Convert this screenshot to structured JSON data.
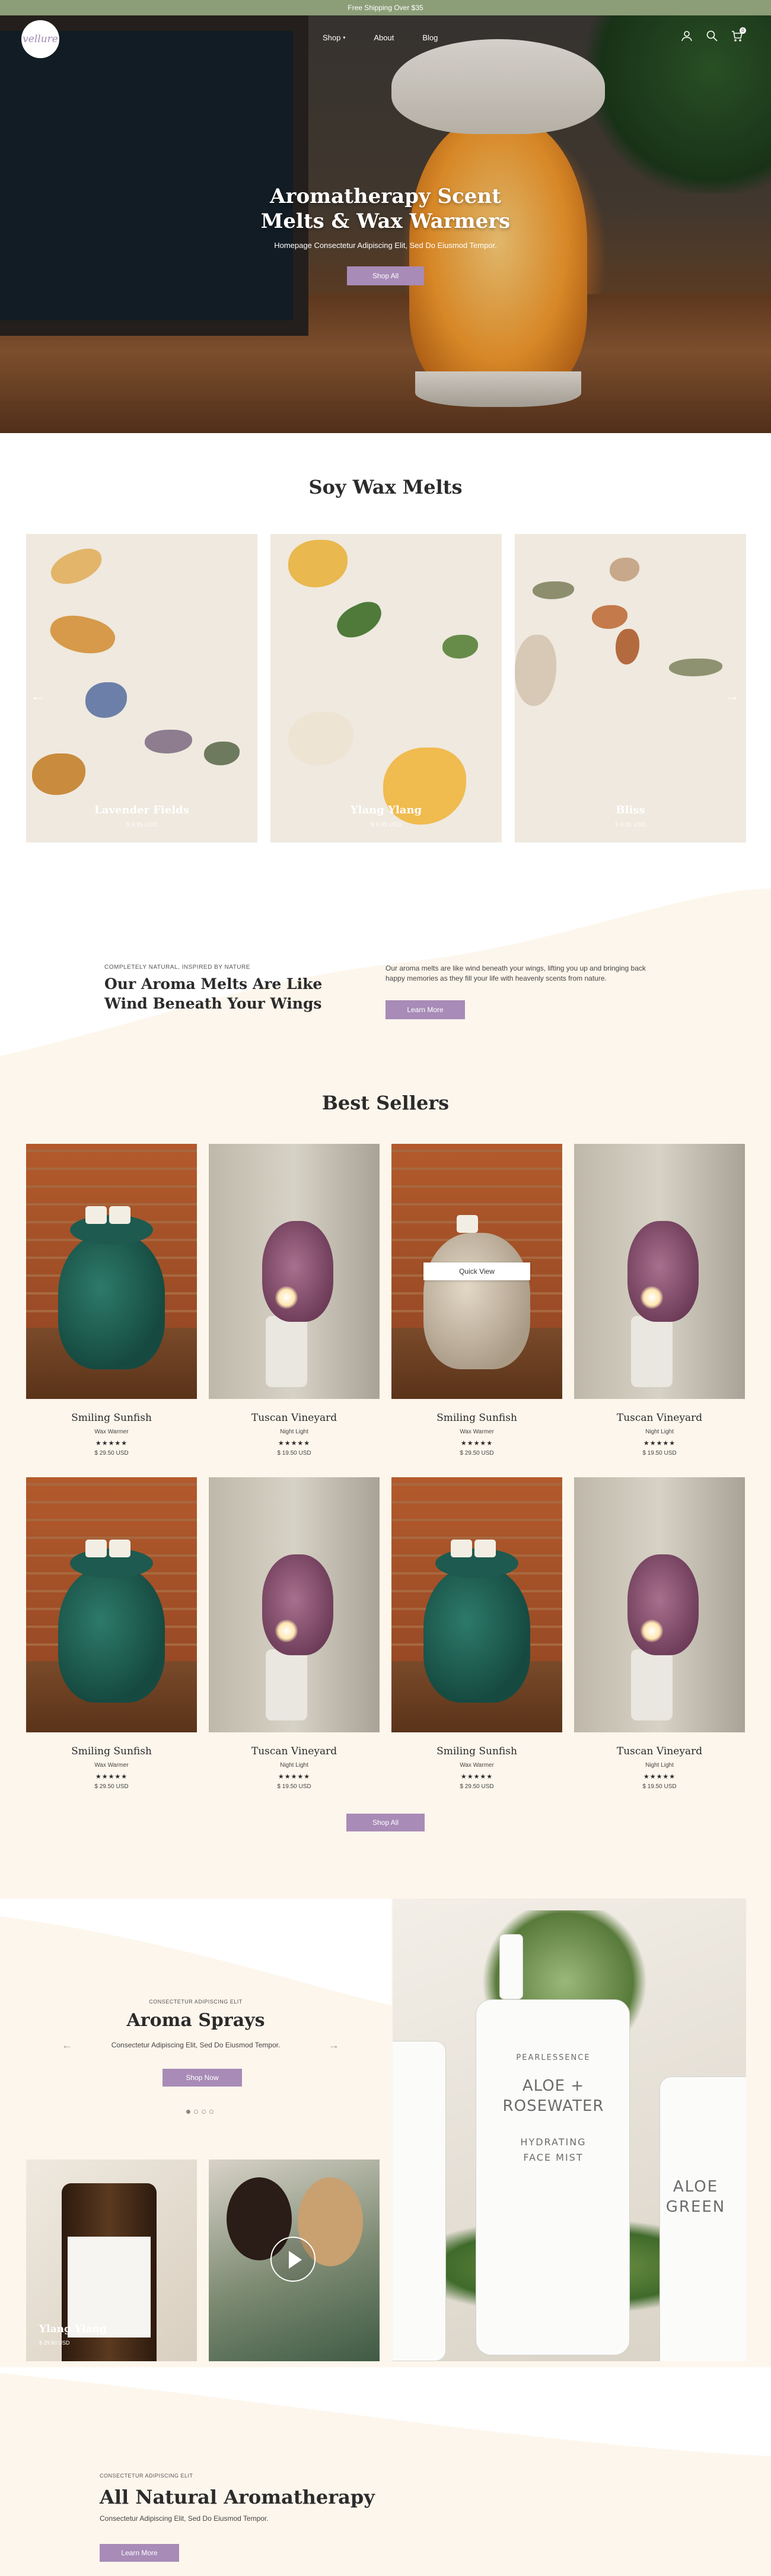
{
  "announcement": "Free Shipping Over $35",
  "nav": {
    "logo": "vellure",
    "links": [
      "Shop",
      "About",
      "Blog"
    ],
    "cart_count": "0"
  },
  "hero": {
    "title_line1": "Aromatherapy Scent",
    "title_line2": "Melts & Wax Warmers",
    "subtitle": "Homepage Consectetur Adipiscing Elit, Sed Do Eiusmod Tempor.",
    "button": "Shop All"
  },
  "melts": {
    "title": "Soy Wax Melts",
    "items": [
      {
        "name": "Lavender Fields",
        "price": "$ 9.95 USD"
      },
      {
        "name": "Ylang Ylang",
        "price": "$ 9.95 USD"
      },
      {
        "name": "Bliss",
        "price": "$ 9.95 USD"
      }
    ]
  },
  "inspired": {
    "eyebrow": "COMPLETELY NATURAL, INSPIRED BY NATURE",
    "title": "Our Aroma Melts Are Like Wind Beneath Your Wings",
    "body": "Our aroma melts are like wind beneath your wings, lifting you up and bringing back happy memories as they fill your life with heavenly scents from nature.",
    "button": "Learn More"
  },
  "best_sellers": {
    "title": "Best Sellers",
    "quick_view": "Quick View",
    "button": "Shop All",
    "products": [
      {
        "name": "Smiling Sunfish",
        "type": "Wax Warmer",
        "stars": "★★★★★",
        "price": "$ 29.50 USD"
      },
      {
        "name": "Tuscan Vineyard",
        "type": "Night Light",
        "stars": "★★★★★",
        "price": "$ 19.50 USD"
      },
      {
        "name": "Smiling Sunfish",
        "type": "Wax Warmer",
        "stars": "★★★★★",
        "price": "$ 29.50 USD"
      },
      {
        "name": "Tuscan Vineyard",
        "type": "Night Light",
        "stars": "★★★★★",
        "price": "$ 19.50 USD"
      },
      {
        "name": "Smiling Sunfish",
        "type": "Wax Warmer",
        "stars": "★★★★★",
        "price": "$ 29.50 USD"
      },
      {
        "name": "Tuscan Vineyard",
        "type": "Night Light",
        "stars": "★★★★★",
        "price": "$ 19.50 USD"
      },
      {
        "name": "Smiling Sunfish",
        "type": "Wax Warmer",
        "stars": "★★★★★",
        "price": "$ 29.50 USD"
      },
      {
        "name": "Tuscan Vineyard",
        "type": "Night Light",
        "stars": "★★★★★",
        "price": "$ 19.50 USD"
      }
    ]
  },
  "sprays": {
    "eyebrow": "CONSECTETUR ADIPISCING ELIT",
    "title": "Aroma Sprays",
    "subtitle": "Consectetur Adipiscing Elit, Sed Do Eiusmod Tempor.",
    "button": "Shop Now",
    "tile_name": "Ylang Ylang",
    "tile_price": "$ 29.50 USD",
    "bottle_brand": "PEARLESSENCE",
    "bottle_name_1": "ALOE +",
    "bottle_name_2": "ROSEWATER",
    "bottle_desc_1": "HYDRATING",
    "bottle_desc_2": "FACE MIST",
    "side_label_1": "ALOE",
    "side_label_2": "GREEN"
  },
  "natural": {
    "eyebrow": "CONSECTETUR ADIPISCING ELIT",
    "title": "All Natural Aromatherapy",
    "subtitle": "Consectetur Adipiscing Elit, Sed Do Eiusmod Tempor.",
    "button": "Learn More"
  },
  "colors": {
    "accent": "#a88bb7",
    "announcement": "#8b9e78",
    "cream": "#fdf6ec"
  },
  "icons": [
    "user-icon",
    "search-icon",
    "cart-icon",
    "chevron-down-icon",
    "arrow-left-icon",
    "arrow-right-icon",
    "play-icon"
  ]
}
